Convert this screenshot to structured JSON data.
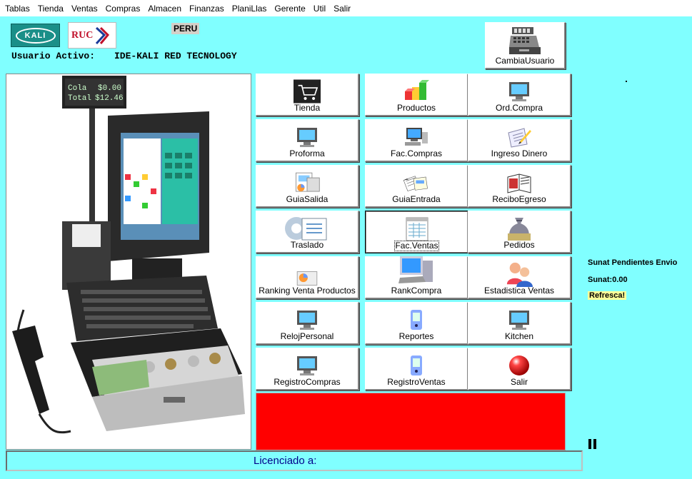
{
  "menu": [
    "Tablas",
    "Tienda",
    "Ventas",
    "Compras",
    "Almacen",
    "Finanzas",
    "PlaniLlas",
    "Gerente",
    "Util",
    "Salir"
  ],
  "logos": {
    "kali": "KALI",
    "ruc": "RUC"
  },
  "country": "PERU",
  "user": {
    "label": "Usuario Activo:",
    "value": "IDE-KALI RED TECNOLOGY"
  },
  "change_user_button": {
    "label": "CambiaUsuario",
    "icon": "cash-register-icon"
  },
  "buttons": [
    {
      "label": "Tienda",
      "icon": "shopping-cart-icon"
    },
    {
      "label": "Productos",
      "icon": "cubes-icon"
    },
    {
      "label": "Ord.Compra",
      "icon": "monitor-icon"
    },
    {
      "label": "Proforma",
      "icon": "monitor-icon"
    },
    {
      "label": "Fac.Compras",
      "icon": "computer-icon"
    },
    {
      "label": "Ingreso Dinero",
      "icon": "pen-document-icon"
    },
    {
      "label": "GuiaSalida",
      "icon": "report-icon"
    },
    {
      "label": "GuiaEntrada",
      "icon": "documents-icon"
    },
    {
      "label": "ReciboEgreso",
      "icon": "book-icon"
    },
    {
      "label": "Traslado",
      "icon": "gear-list-icon"
    },
    {
      "label": "Fac.Ventas",
      "icon": "invoice-icon"
    },
    {
      "label": "Pedidos",
      "icon": "money-bag-icon"
    },
    {
      "label": "Ranking Venta Productos",
      "icon": "chart-icon"
    },
    {
      "label": "RankCompra",
      "icon": "computer-icon"
    },
    {
      "label": "Estadistica Ventas",
      "icon": "users-icon"
    },
    {
      "label": "RelojPersonal",
      "icon": "monitor-icon"
    },
    {
      "label": "Reportes",
      "icon": "handheld-icon"
    },
    {
      "label": "Kitchen",
      "icon": "monitor-icon"
    },
    {
      "label": "RegistroCompras",
      "icon": "monitor-icon"
    },
    {
      "label": "RegistroVentas",
      "icon": "handheld-icon"
    },
    {
      "label": "Salir",
      "icon": "red-ball-icon"
    }
  ],
  "pos_display": {
    "line1": "Cola",
    "line2": "Total",
    "value1": "$0.00",
    "value2": "$12.46"
  },
  "sunat": {
    "pending": "Sunat Pendientes Envio",
    "value": "Sunat:0.00",
    "refresh": "Refresca!"
  },
  "status": {
    "licensed": "Licenciado a:"
  },
  "colors": {
    "background": "#80ffff",
    "alert_panel": "#ff0000",
    "status_text": "#00008b"
  }
}
